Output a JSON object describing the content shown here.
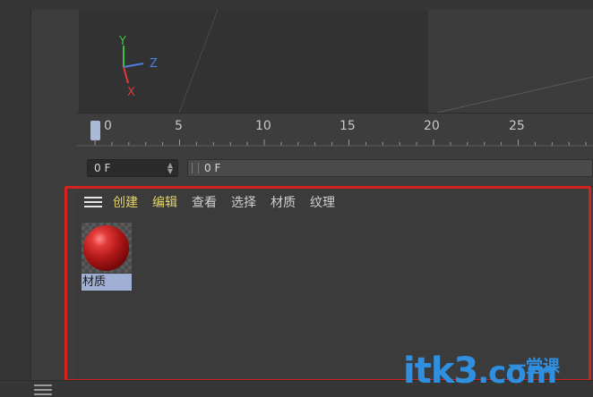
{
  "timeline": {
    "ruler_labels": [
      "0",
      "5",
      "10",
      "15",
      "20",
      "25"
    ],
    "current_frame": "0 F",
    "frame_range": "0 F"
  },
  "material_manager": {
    "menu": {
      "create": "创建",
      "edit": "编辑",
      "view": "查看",
      "select": "选择",
      "material": "材质",
      "texture": "纹理"
    },
    "materials": [
      {
        "name": "材质",
        "color": "#c21e1e"
      }
    ]
  },
  "viewport": {
    "axis_y": "Y",
    "axis_z": "Z",
    "axis_x": "X"
  },
  "watermark": {
    "logo": "itk3",
    "text": "一堂课",
    "domain": ".com"
  },
  "colors": {
    "highlight": "#d6221d",
    "menu_yellow": "#e2d36b",
    "selection": "#9fb0d4",
    "accent_blue": "#2f8fe0"
  }
}
